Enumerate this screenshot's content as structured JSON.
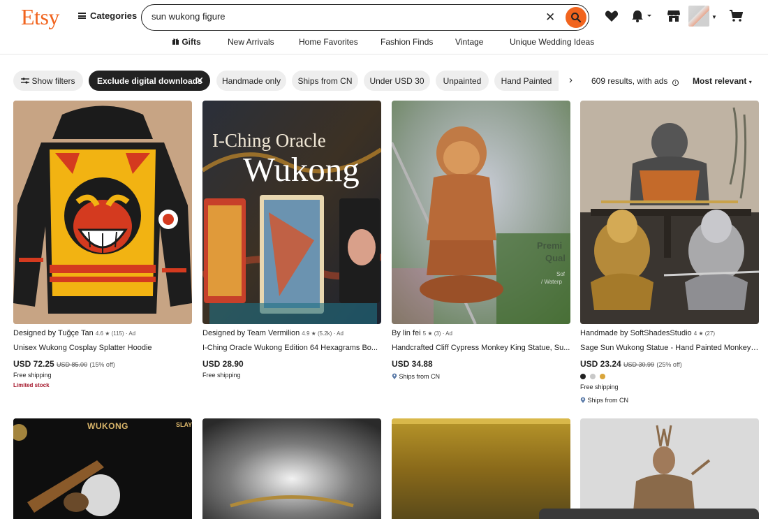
{
  "header": {
    "logo": "Etsy",
    "categories_label": "Categories",
    "search_value": "sun wukong figure",
    "search_clear": "✕"
  },
  "nav": [
    "Gifts",
    "New Arrivals",
    "Home Favorites",
    "Fashion Finds",
    "Vintage",
    "Unique Wedding Ideas"
  ],
  "filters": {
    "show_filters": "Show filters",
    "chips": [
      "Exclude digital downloads",
      "Handmade only",
      "Ships from CN",
      "Under USD 30",
      "Unpainted",
      "Hand Painted"
    ],
    "results": "609 results, with ads",
    "sort": "Most relevant"
  },
  "products": [
    {
      "shop_prefix": "Designed by",
      "shop_name": "Tuğçe Tan",
      "rating": "4.6 ★ (115) · Ad",
      "title": "Unisex Wukong Cosplay Splatter Hoodie",
      "price": "USD 72.25",
      "orig_price": "USD 85.00",
      "discount": "(15% off)",
      "shipping": "Free shipping",
      "note": "Limited stock"
    },
    {
      "shop_prefix": "Designed by",
      "shop_name": "Team Vermilion",
      "rating": "4.9 ★ (5.2k) · Ad",
      "title": "I-Ching Oracle Wukong Edition 64 Hexagrams Bo...",
      "price": "USD 28.90",
      "shipping": "Free shipping",
      "img_text": {
        "line1": "I-Ching Oracle",
        "line2": "Wukong"
      }
    },
    {
      "shop_prefix": "By",
      "shop_name": "lin fei",
      "rating": "5 ★ (3) · Ad",
      "title": "Handcrafted Cliff Cypress Monkey King Statue, Su...",
      "price": "USD 34.88",
      "ships_from": "Ships from CN",
      "img_text": {
        "line1": "Premi",
        "line2": "Qual",
        "line3": "Sof",
        "line4": "/ Waterp"
      }
    },
    {
      "shop_prefix": "Handmade by",
      "shop_name": "SoftShadesStudio",
      "rating": "4 ★ (27)",
      "title": "Sage Sun Wukong Statue - Hand Painted Monkey ...",
      "price": "USD 23.24",
      "orig_price": "USD 30.99",
      "discount": "(25% off)",
      "shipping": "Free shipping",
      "ships_from": "Ships from CN",
      "swatches": [
        "#222222",
        "#c8c8c8",
        "#d9a53a"
      ]
    }
  ],
  "row2": {
    "card1_text": "WUKONG",
    "card1_text2": "SLAYS"
  },
  "colors": {
    "brand": "#f1641e",
    "dark_chip": "#222222",
    "chip": "#eeeeee",
    "limited": "#a61a2e"
  }
}
